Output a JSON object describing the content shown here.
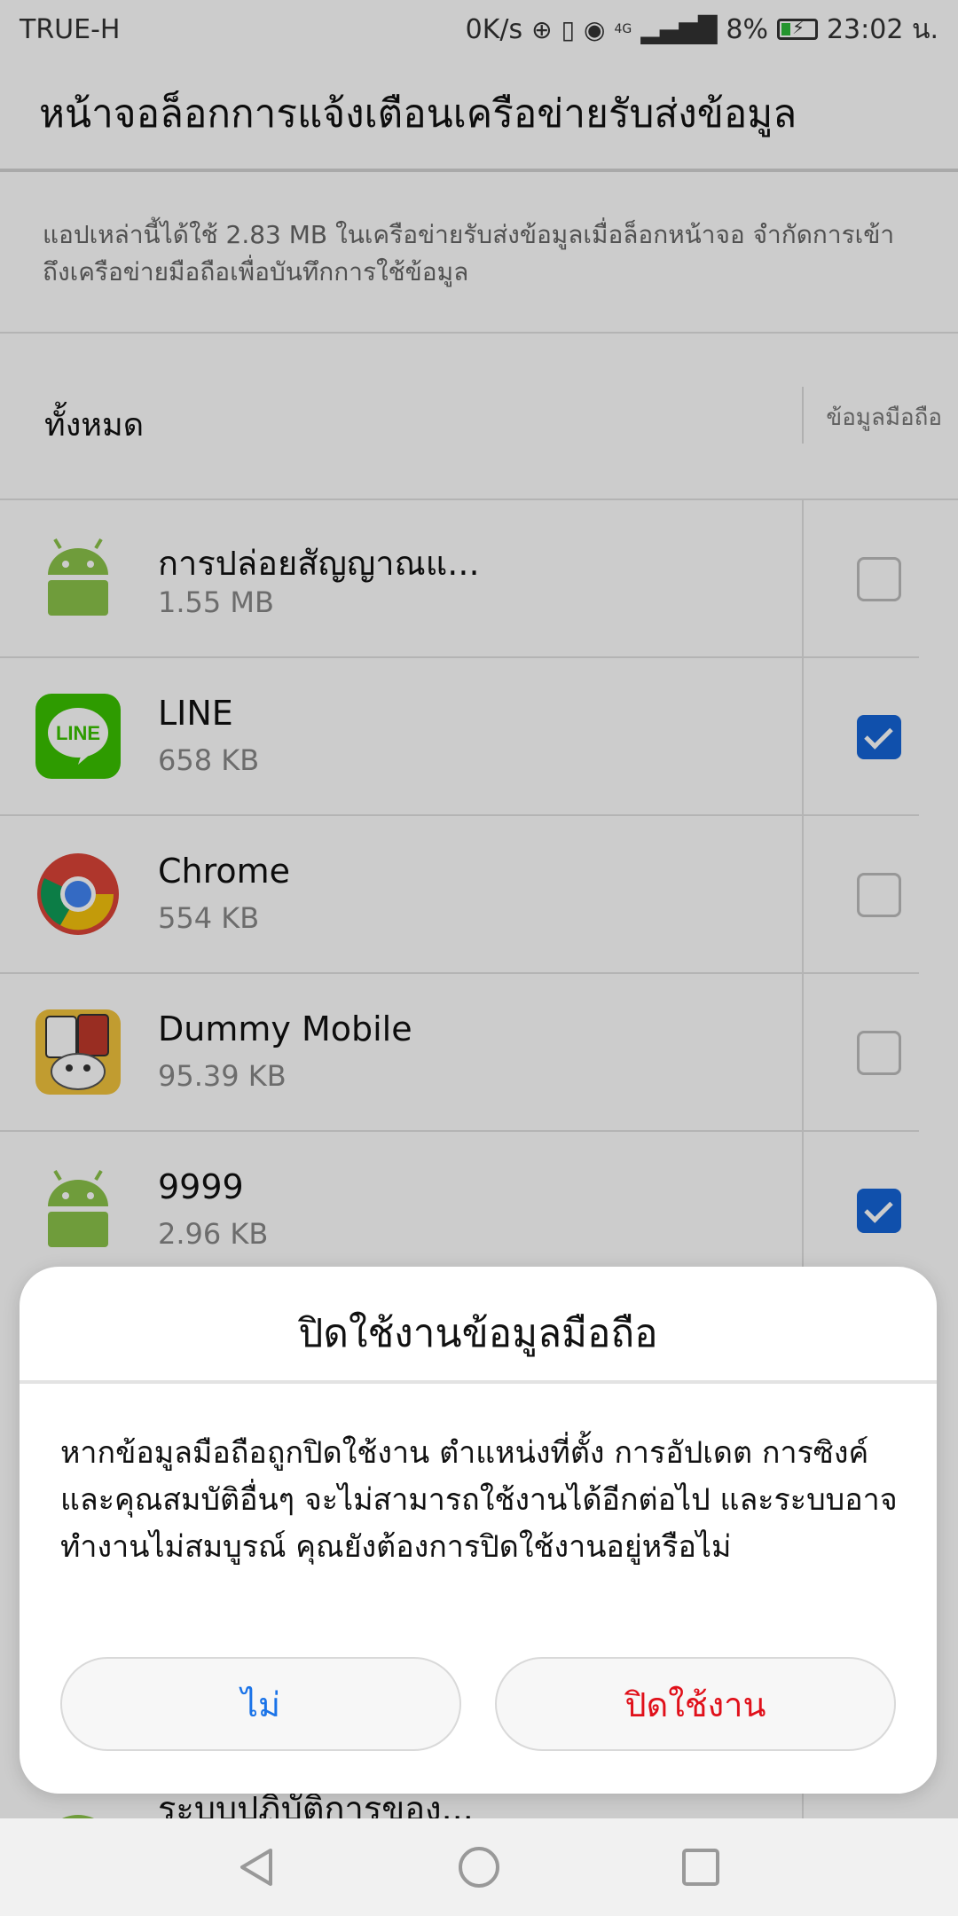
{
  "status": {
    "carrier": "TRUE-H",
    "speed": "0K/s",
    "network": "4G",
    "battery": "8%",
    "time": "23:02 น."
  },
  "title": "หน้าจอล็อกการแจ้งเตือนเครือข่ายรับส่งข้อมูล",
  "description": "แอปเหล่านี้ได้ใช้ 2.83 MB ในเครือข่ายรับส่งข้อมูลเมื่อล็อกหน้าจอ จำกัดการเข้าถึงเครือข่ายมือถือเพื่อบันทึกการใช้ข้อมูล",
  "header": {
    "all_label": "ทั้งหมด",
    "mobile_label": "ข้อมูลมือถือ"
  },
  "apps": [
    {
      "name": "การปล่อยสัญญาณแ...",
      "size": "1.55 MB",
      "icon": "android-icon",
      "checked": false
    },
    {
      "name": "LINE",
      "size": "658 KB",
      "icon": "line-app-icon",
      "checked": true
    },
    {
      "name": "Chrome",
      "size": "554 KB",
      "icon": "chrome-icon",
      "checked": false
    },
    {
      "name": "Dummy Mobile",
      "size": "95.39 KB",
      "icon": "dummy-mobile-icon",
      "checked": false
    },
    {
      "name": "9999",
      "size": "2.96 KB",
      "icon": "android-icon",
      "checked": true
    }
  ],
  "partial_app_name": "ระบบปฏิบัติการของ...",
  "line_logo_text": "LINE",
  "dialog": {
    "title": "ปิดใช้งานข้อมูลมือถือ",
    "message": "หากข้อมูลมือถือถูกปิดใช้งาน ตำแหน่งที่ตั้ง การอัปเดต การซิงค์ และคุณสมบัติอื่นๆ จะไม่สามารถใช้งานได้อีกต่อไป และระบบอาจทำงานไม่สมบูรณ์ คุณยังต้องการปิดใช้งานอยู่หรือไม่",
    "cancel_label": "ไม่",
    "confirm_label": "ปิดใช้งาน"
  },
  "colors": {
    "accent": "#1565d8",
    "danger": "#e0101a",
    "android": "#8bc34a",
    "line": "#3ac200"
  }
}
